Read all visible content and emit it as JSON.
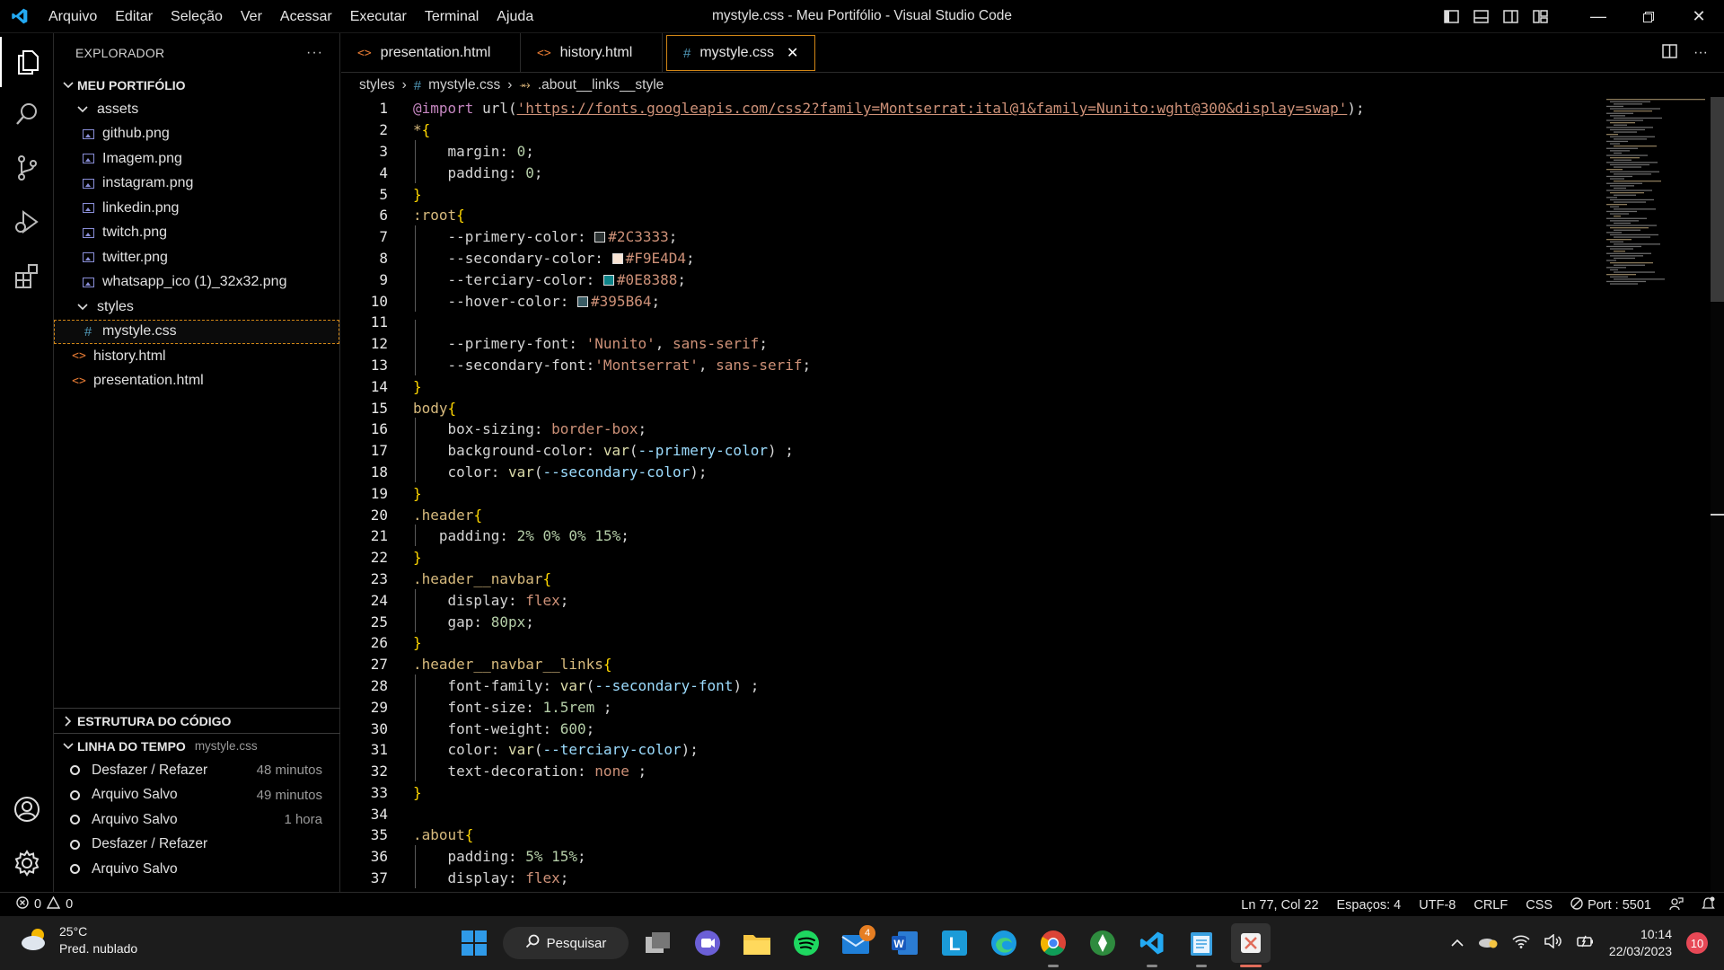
{
  "window": {
    "title": "mystyle.css - Meu Portifólio - Visual Studio Code",
    "menu": [
      "Arquivo",
      "Editar",
      "Seleção",
      "Ver",
      "Acessar",
      "Executar",
      "Terminal",
      "Ajuda"
    ]
  },
  "sidebar": {
    "header": "EXPLORADOR",
    "more": "···",
    "root": "MEU PORTIFÓLIO",
    "tree": [
      {
        "label": "assets",
        "type": "folder",
        "depth": 1
      },
      {
        "label": "github.png",
        "type": "image",
        "depth": 2
      },
      {
        "label": "Imagem.png",
        "type": "image",
        "depth": 2
      },
      {
        "label": "instagram.png",
        "type": "image",
        "depth": 2
      },
      {
        "label": "linkedin.png",
        "type": "image",
        "depth": 2
      },
      {
        "label": "twitch.png",
        "type": "image",
        "depth": 2
      },
      {
        "label": "twitter.png",
        "type": "image",
        "depth": 2
      },
      {
        "label": "whatsapp_ico (1)_32x32.png",
        "type": "image",
        "depth": 2
      },
      {
        "label": "styles",
        "type": "folder",
        "depth": 1
      },
      {
        "label": "mystyle.css",
        "type": "css",
        "depth": 2,
        "selected": true
      },
      {
        "label": "history.html",
        "type": "html",
        "depth": 1
      },
      {
        "label": "presentation.html",
        "type": "html",
        "depth": 1
      }
    ],
    "outline_title": "ESTRUTURA DO CÓDIGO",
    "timeline_title": "LINHA DO TEMPO",
    "timeline_file": "mystyle.css",
    "timeline": [
      {
        "label": "Desfazer / Refazer",
        "time": "48 minutos"
      },
      {
        "label": "Arquivo Salvo",
        "time": "49 minutos"
      },
      {
        "label": "Arquivo Salvo",
        "time": "1 hora"
      },
      {
        "label": "Desfazer / Refazer",
        "time": ""
      },
      {
        "label": "Arquivo Salvo",
        "time": ""
      }
    ]
  },
  "tabs": [
    {
      "label": "presentation.html",
      "icon": "html-icon",
      "active": false
    },
    {
      "label": "history.html",
      "icon": "html-icon",
      "active": false
    },
    {
      "label": "mystyle.css",
      "icon": "css-icon",
      "active": true
    }
  ],
  "breadcrumb": [
    "styles",
    "mystyle.css",
    ".about__links__style"
  ],
  "code": {
    "lines": [
      {
        "n": 1,
        "html": "<span class='t-at'>@import</span> url(<span class='t-str' style='text-decoration:underline'>'https://fonts.googleapis.com/css2?family=Montserrat:ital@1&amp;family=Nunito:wght@300&amp;display=swap'</span>);"
      },
      {
        "n": 2,
        "html": "<span class='t-sel'>*</span><span class='t-brace'>{</span>"
      },
      {
        "n": 3,
        "guide": true,
        "html": "    margin: <span class='t-num'>0</span>;"
      },
      {
        "n": 4,
        "guide": true,
        "html": "    padding: <span class='t-num'>0</span>;"
      },
      {
        "n": 5,
        "html": "<span class='t-brace'>}</span>"
      },
      {
        "n": 6,
        "html": "<span class='t-sel'>:root</span><span class='t-brace'>{</span>"
      },
      {
        "n": 7,
        "guide": true,
        "html": "    --primery-color: <span class='swatch' style='background:#2C3333'></span><span class='t-val'>#2C3333</span>;"
      },
      {
        "n": 8,
        "guide": true,
        "html": "    --secondary-color: <span class='swatch' style='background:#F9E4D4'></span><span class='t-val'>#F9E4D4</span>;"
      },
      {
        "n": 9,
        "guide": true,
        "html": "    --terciary-color: <span class='swatch' style='background:#0E8388'></span><span class='t-val'>#0E8388</span>;"
      },
      {
        "n": 10,
        "guide": true,
        "html": "    --hover-color: <span class='swatch' style='background:#395B64'></span><span class='t-val'>#395B64</span>;"
      },
      {
        "n": 11,
        "guide": true,
        "html": ""
      },
      {
        "n": 12,
        "guide": true,
        "html": "    --primery-font: <span class='t-str'>'Nunito'</span>, <span class='t-val'>sans-serif</span>;"
      },
      {
        "n": 13,
        "guide": true,
        "html": "    --secondary-font:<span class='t-str'>'Montserrat'</span>, <span class='t-val'>sans-serif</span>;"
      },
      {
        "n": 14,
        "html": "<span class='t-brace'>}</span>"
      },
      {
        "n": 15,
        "html": "<span class='t-sel'>body</span><span class='t-brace'>{</span>"
      },
      {
        "n": 16,
        "guide": true,
        "html": "    box-sizing: <span class='t-val'>border-box</span>;"
      },
      {
        "n": 17,
        "guide": true,
        "html": "    background-color: <span class='t-fn'>var</span>(<span class='t-var'>--primery-color</span>) ;"
      },
      {
        "n": 18,
        "guide": true,
        "html": "    color: <span class='t-fn'>var</span>(<span class='t-var'>--secondary-color</span>);"
      },
      {
        "n": 19,
        "html": "<span class='t-brace'>}</span>"
      },
      {
        "n": 20,
        "html": "<span class='t-sel'>.header</span><span class='t-brace'>{</span>"
      },
      {
        "n": 21,
        "guide": true,
        "html": "   padding: <span class='t-num'>2%</span> <span class='t-num'>0%</span> <span class='t-num'>0%</span> <span class='t-num'>15%</span>;"
      },
      {
        "n": 22,
        "html": "<span class='t-brace'>}</span>"
      },
      {
        "n": 23,
        "html": "<span class='t-sel'>.header__navbar</span><span class='t-brace'>{</span>"
      },
      {
        "n": 24,
        "guide": true,
        "html": "    display: <span class='t-val'>flex</span>;"
      },
      {
        "n": 25,
        "guide": true,
        "html": "    gap: <span class='t-num'>80px</span>;"
      },
      {
        "n": 26,
        "html": "<span class='t-brace'>}</span>"
      },
      {
        "n": 27,
        "html": "<span class='t-sel'>.header__navbar__links</span><span class='t-brace'>{</span>"
      },
      {
        "n": 28,
        "guide": true,
        "html": "    font-family: <span class='t-fn'>var</span>(<span class='t-var'>--secondary-font</span>) ;"
      },
      {
        "n": 29,
        "guide": true,
        "html": "    font-size: <span class='t-num'>1.5rem</span> ;"
      },
      {
        "n": 30,
        "guide": true,
        "html": "    font-weight: <span class='t-num'>600</span>;"
      },
      {
        "n": 31,
        "guide": true,
        "html": "    color: <span class='t-fn'>var</span>(<span class='t-var'>--terciary-color</span>);"
      },
      {
        "n": 32,
        "guide": true,
        "html": "    text-decoration: <span class='t-val'>none</span> ;"
      },
      {
        "n": 33,
        "html": "<span class='t-brace'>}</span>"
      },
      {
        "n": 34,
        "html": ""
      },
      {
        "n": 35,
        "html": "<span class='t-sel'>.about</span><span class='t-brace'>{</span>"
      },
      {
        "n": 36,
        "guide": true,
        "html": "    padding: <span class='t-num'>5%</span> <span class='t-num'>15%</span>;"
      },
      {
        "n": 37,
        "guide": true,
        "html": "    display: <span class='t-val'>flex</span>;"
      }
    ]
  },
  "status": {
    "errors": "0",
    "warnings": "0",
    "position": "Ln 77, Col 22",
    "spaces": "Espaços: 4",
    "encoding": "UTF-8",
    "eol": "CRLF",
    "language": "CSS",
    "port": "Port : 5501"
  },
  "taskbar": {
    "temperature": "25°C",
    "weather": "Pred. nublado",
    "search": "Pesquisar",
    "mail_badge": "4",
    "time": "10:14",
    "date": "22/03/2023",
    "notifications": "10"
  },
  "colors": {
    "accent_tab_border": "#d18616",
    "vscode_blue": "#23a9f2"
  }
}
